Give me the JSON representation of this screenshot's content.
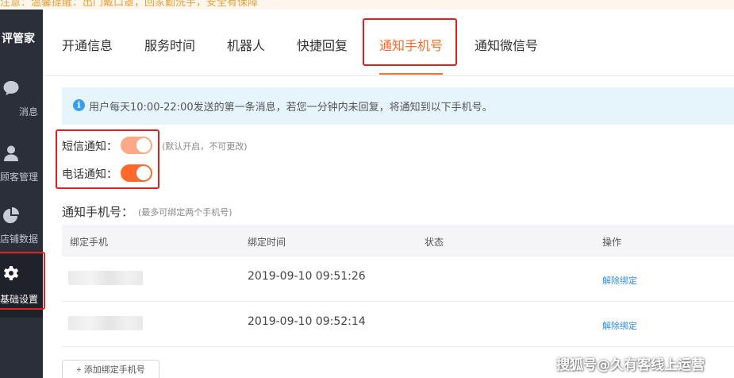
{
  "top_notice": "注意：温馨提醒：出门戴口罩，回家勤洗手，安全有保障",
  "sidebar": {
    "brand": "评管家",
    "items": [
      {
        "label": "消息",
        "icon": "chat-bubble-icon",
        "active": false
      },
      {
        "label": "顾客管理",
        "icon": "user-icon",
        "active": false
      },
      {
        "label": "店铺数据",
        "icon": "pie-chart-icon",
        "active": false
      },
      {
        "label": "基础设置",
        "icon": "gear-icon",
        "active": true
      }
    ]
  },
  "tabs": [
    {
      "label": "开通信息",
      "active": false
    },
    {
      "label": "服务时间",
      "active": false
    },
    {
      "label": "机器人",
      "active": false
    },
    {
      "label": "快捷回复",
      "active": false
    },
    {
      "label": "通知手机号",
      "active": true
    },
    {
      "label": "通知微信号",
      "active": false
    }
  ],
  "info": {
    "icon": "info-icon",
    "text": "用户每天10:00-22:00发送的第一条消息，若您一分钟内未回复，将通知到以下手机号。"
  },
  "notifications": {
    "sms_label": "短信通知：",
    "sms_enabled": true,
    "sms_hint": "(默认开启，不可更改)",
    "phone_label": "电话通知：",
    "phone_enabled": true
  },
  "phones_section": {
    "title": "通知手机号：",
    "hint": "(最多可绑定两个手机号)"
  },
  "table": {
    "headers": [
      "绑定手机",
      "绑定时间",
      "状态",
      "操作"
    ],
    "rows": [
      {
        "phone": "",
        "time": "2019-09-10 09:51:26",
        "status": "",
        "action": "解除绑定"
      },
      {
        "phone": "",
        "time": "2019-09-10 09:52:14",
        "status": "",
        "action": "解除绑定"
      }
    ]
  },
  "add_button": "+ 添加绑定手机号",
  "watermark": "搜狐号@久有客线上运营",
  "colors": {
    "accent": "#ff6a2c",
    "sidebar_bg": "#2b2f3a",
    "info_bg": "#e6f4fc",
    "link": "#2d8cf0",
    "highlight_box": "#e02020"
  }
}
